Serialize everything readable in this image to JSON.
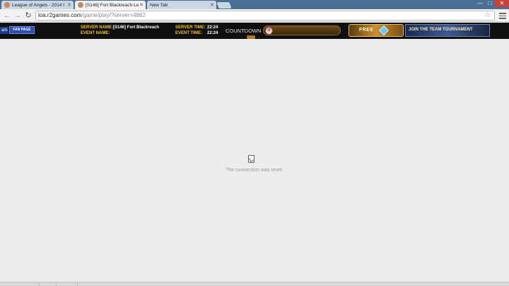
{
  "browser": {
    "tabs": [
      {
        "title": "League of Angels - 2014 I",
        "active": false
      },
      {
        "title": "[S146] Fort Blackreach-Le",
        "active": true
      },
      {
        "title": "New Tab",
        "active": false
      }
    ],
    "url": {
      "domain": "loa.r2games.com",
      "path": "/game/play/?server=4862"
    },
    "window_controls": {
      "minimize": "—",
      "maximize": "□",
      "close": "✕"
    }
  },
  "game_header": {
    "left_tag": "ark",
    "fan_page_label": "FAN PAGE",
    "server_name_label": "SERVER NAME:",
    "server_name_value": "[S146] Fort Blackreach",
    "event_name_label": "EVENT NAME:",
    "server_time_label": "SERVER TIME:",
    "server_time_value": "22:24",
    "event_time_label": "EVENT TIME:",
    "event_time_value": "22:24",
    "countdown_label": "COUNTDOWN",
    "free_label": "FREE",
    "join_label": "JOIN THE TEAM TOURNAMENT"
  },
  "error": {
    "message": "The connection was reset."
  },
  "icons": {
    "back": "back-arrow-icon",
    "forward": "forward-arrow-icon",
    "reload": "reload-icon",
    "star": "bookmark-star-icon",
    "menu": "hamburger-menu-icon",
    "error": "broken-page-icon"
  }
}
